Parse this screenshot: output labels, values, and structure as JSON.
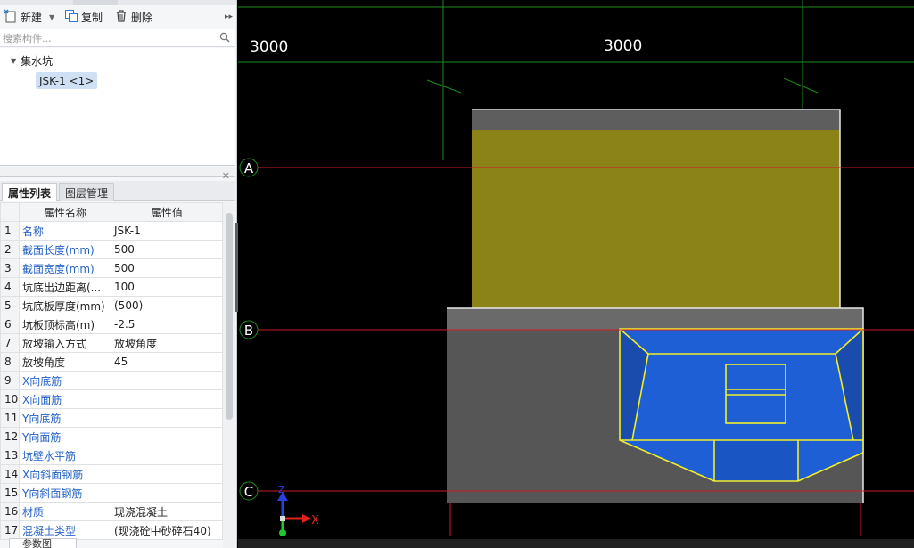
{
  "toolbar": {
    "new_label": "新建",
    "copy_label": "复制",
    "delete_label": "删除"
  },
  "search": {
    "placeholder": "搜索构件..."
  },
  "tree": {
    "group": "集水坑",
    "item": "JSK-1 <1>"
  },
  "tabs": {
    "properties": "属性列表",
    "layers": "图层管理"
  },
  "table": {
    "col_name": "属性名称",
    "col_value": "属性值",
    "rows": [
      {
        "n": "1",
        "name": "名称",
        "value": "JSK-1",
        "blue": true
      },
      {
        "n": "2",
        "name": "截面长度(mm)",
        "value": "500",
        "blue": true
      },
      {
        "n": "3",
        "name": "截面宽度(mm)",
        "value": "500",
        "blue": true
      },
      {
        "n": "4",
        "name": "坑底出边距离(...",
        "value": "100",
        "blue": false
      },
      {
        "n": "5",
        "name": "坑底板厚度(mm)",
        "value": "(500)",
        "blue": false
      },
      {
        "n": "6",
        "name": "坑板顶标高(m)",
        "value": "-2.5",
        "blue": false
      },
      {
        "n": "7",
        "name": "放坡输入方式",
        "value": "放坡角度",
        "blue": false
      },
      {
        "n": "8",
        "name": "放坡角度",
        "value": "45",
        "blue": false
      },
      {
        "n": "9",
        "name": "X向底筋",
        "value": "",
        "blue": true
      },
      {
        "n": "10",
        "name": "X向面筋",
        "value": "",
        "blue": true
      },
      {
        "n": "11",
        "name": "Y向底筋",
        "value": "",
        "blue": true
      },
      {
        "n": "12",
        "name": "Y向面筋",
        "value": "",
        "blue": true
      },
      {
        "n": "13",
        "name": "坑壁水平筋",
        "value": "",
        "blue": true
      },
      {
        "n": "14",
        "name": "X向斜面钢筋",
        "value": "",
        "blue": true
      },
      {
        "n": "15",
        "name": "Y向斜面钢筋",
        "value": "",
        "blue": true
      },
      {
        "n": "16",
        "name": "材质",
        "value": "现浇混凝土",
        "blue": true
      },
      {
        "n": "17",
        "name": "混凝土类型",
        "value": "(现浇砼中砂碎石40)",
        "blue": true
      }
    ]
  },
  "bottom_tab": "参数图",
  "viewport": {
    "dim_labels": [
      "3000",
      "3000"
    ],
    "axis_labels": [
      "A",
      "B",
      "C"
    ],
    "axis_x": "X",
    "axis_z": "Z",
    "colors": {
      "background": "#000000",
      "green_grid": "#1e8c1e",
      "red_axis": "#d11a2a",
      "olive": "#8b8317",
      "grey": "#565656",
      "pit_blue": "#1f5fd6",
      "pit_edge": "#f2ee2a"
    }
  }
}
